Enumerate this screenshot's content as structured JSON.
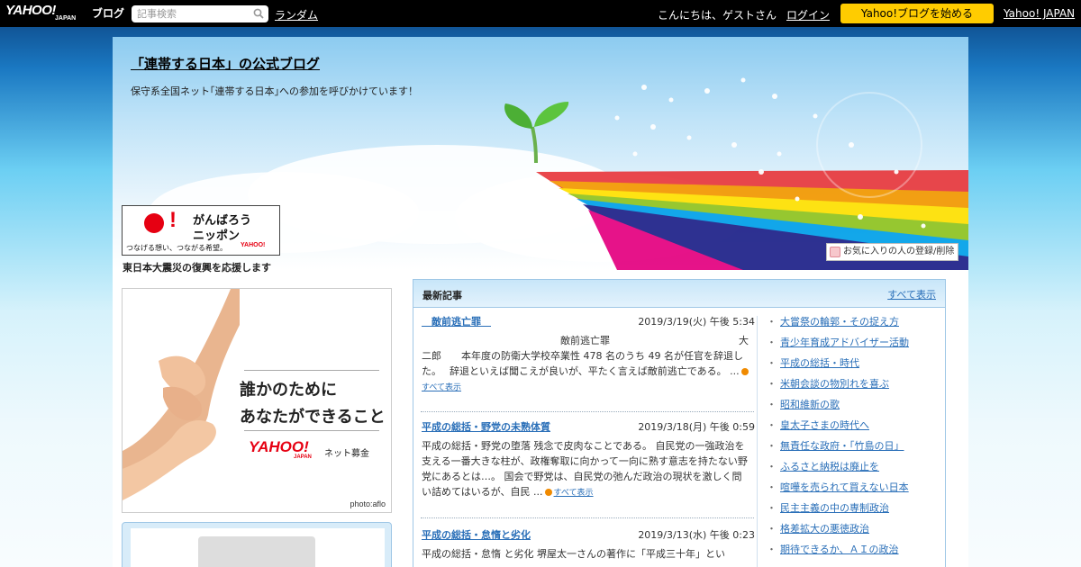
{
  "topbar": {
    "logo": "YAHOO!",
    "logo_sub": "JAPAN",
    "logo_service": "ブログ",
    "search_placeholder": "記事検索",
    "random_link": "ランダム",
    "greeting": "こんにちは、ゲストさん",
    "login_link": "ログイン",
    "start_button": "Yahoo!ブログを始める",
    "yahoo_japan_link": "Yahoo! JAPAN"
  },
  "header": {
    "title": "「連帯する日本」の公式ブログ",
    "description": "保守系全国ネット｢連帯する日本｣への参加を呼びかけています！",
    "favorite_button": "お気に入りの人の登録/削除"
  },
  "ganbaro": {
    "line1": "がんばろう",
    "line2": "ニッポン",
    "tagline": "つなげる想い、つながる希望。",
    "logo": "YAHOO!",
    "caption": "東日本大震災の復興を応援します"
  },
  "banner": {
    "line1": "誰かのために",
    "line2": "あなたができること",
    "logo": "YAHOO!",
    "logo_sub": "JAPAN",
    "service": "ネット募金",
    "credit": "photo:aflo"
  },
  "recent": {
    "title": "最新記事",
    "see_all": "すべて表示",
    "articles": [
      {
        "title": "　敵前逃亡罪　",
        "date": "2019/3/19(火) 午後 5:34",
        "body": "　　　　　　　　　　　　　　敵前逃亡罪　　　　　　　　　　　　　大二郎　　本年度の防衛大学校卒業性 478 名のうち 49 名が任官を辞退した。　 辞退といえば聞こえが良いが、平たく言えば敵前逃亡である。 ...",
        "more": "すべて表示"
      },
      {
        "title": "平成の総括・野党の未熟体質",
        "date": "2019/3/18(月) 午後 0:59",
        "body": "平成の総括・野党の堕落 残念で皮肉なことである。 自民党の一強政治を支える一番大きな柱が、政権奪取に向かって一向に熟す意志を持たない野党にあるとは…。 国会で野党は、自民党の弛んだ政治の現状を激しく問い詰めてはいるが、自民 ...",
        "more": "すべて表示"
      },
      {
        "title": "平成の総括・怠惰と劣化",
        "date": "2019/3/13(水) 午後 0:23",
        "body": "平成の総括・怠惰 と劣化 堺屋太一さんの著作に「平成三十年」とい",
        "more": "すべて表示"
      }
    ],
    "side_links": [
      "大嘗祭の輪郭・その捉え方",
      "青少年育成アドバイザー活動",
      "平成の総括・時代",
      "米朝会談の物別れを喜ぶ",
      "昭和維新の歌",
      "皇太子さまの時代へ",
      "無責任な政府・「竹島の日」",
      "ふるさと納税は廃止を",
      "喧嘩を売られて買えない日本",
      "民主主義の中の専制政治",
      "格差拡大の悪徳政治",
      "期待できるか、ＡＩの政治"
    ]
  }
}
